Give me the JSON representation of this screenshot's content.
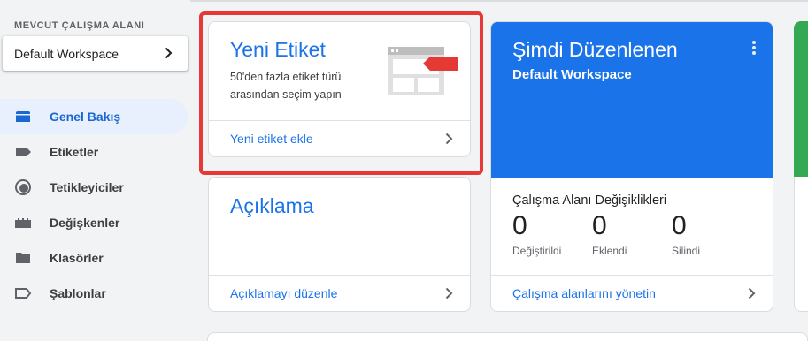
{
  "sidebar": {
    "workspace_label": "MEVCUT ÇALIŞMA ALANI",
    "workspace_name": "Default Workspace",
    "items": [
      {
        "label": "Genel Bakış",
        "icon": "overview-icon",
        "active": true
      },
      {
        "label": "Etiketler",
        "icon": "tag-icon",
        "active": false
      },
      {
        "label": "Tetikleyiciler",
        "icon": "trigger-icon",
        "active": false
      },
      {
        "label": "Değişkenler",
        "icon": "variables-icon",
        "active": false
      },
      {
        "label": "Klasörler",
        "icon": "folder-icon",
        "active": false
      },
      {
        "label": "Şablonlar",
        "icon": "template-icon",
        "active": false
      }
    ]
  },
  "new_tag_card": {
    "title": "Yeni Etiket",
    "description": "50'den fazla etiket türü arasından seçim yapın",
    "action": "Yeni etiket ekle"
  },
  "description_card": {
    "title": "Açıklama",
    "action": "Açıklamayı düzenle"
  },
  "editing_card": {
    "title": "Şimdi Düzenlenen",
    "subtitle": "Default Workspace",
    "changes_title": "Çalışma Alanı Değişiklikleri",
    "stats": [
      {
        "value": "0",
        "label": "Değiştirildi"
      },
      {
        "value": "0",
        "label": "Eklendi"
      },
      {
        "value": "0",
        "label": "Silindi"
      }
    ],
    "action": "Çalışma alanlarını yönetin"
  },
  "colors": {
    "accent": "#1a73e8",
    "highlight": "#e53935",
    "green": "#34a853"
  }
}
